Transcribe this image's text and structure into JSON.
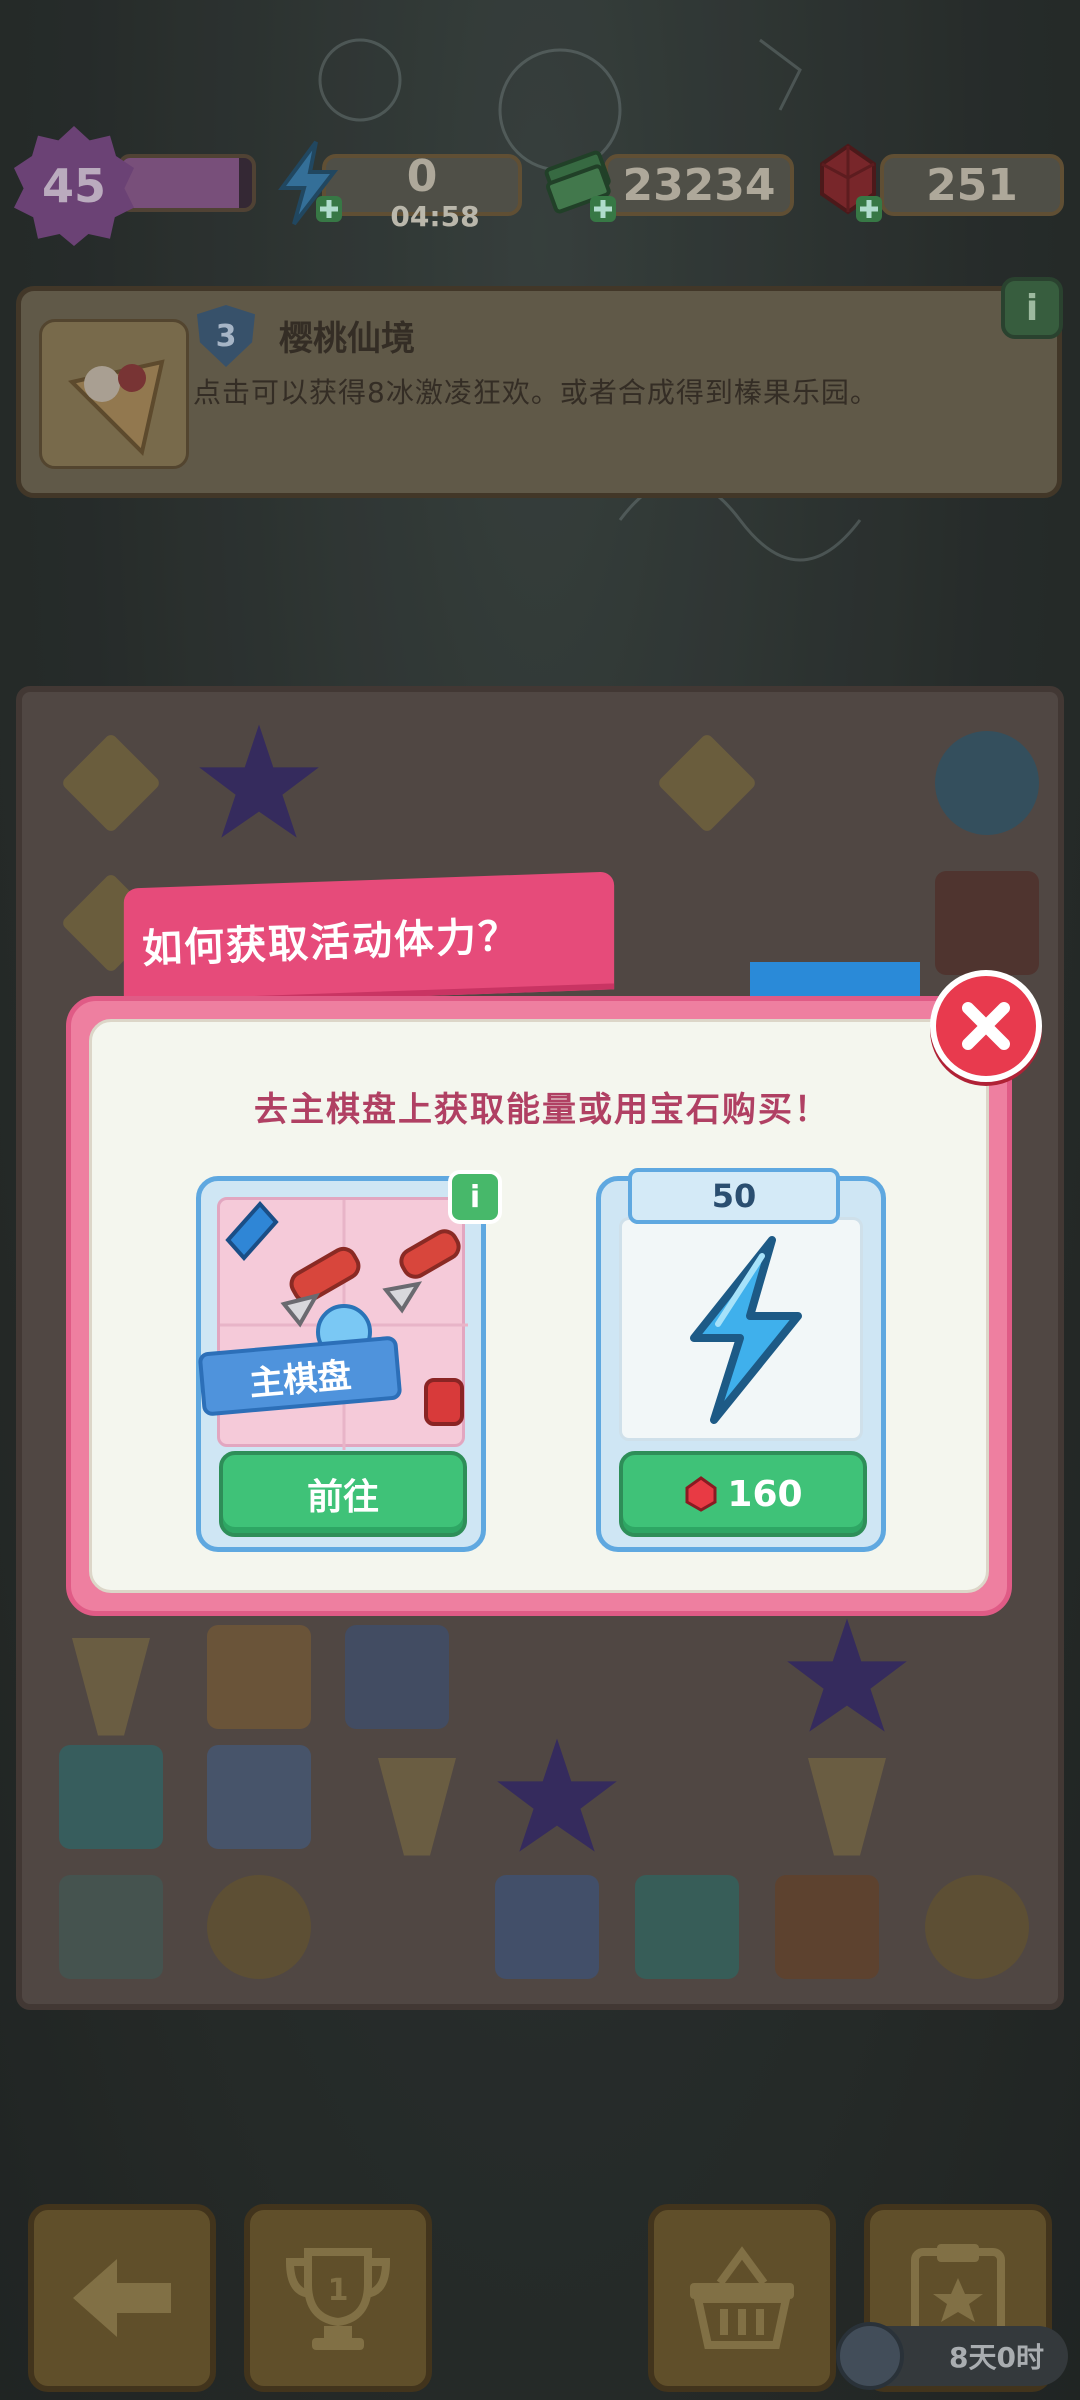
{
  "hud": {
    "level": "45",
    "xp_progress": 0.9,
    "energy_value": "0",
    "energy_timer": "04:58",
    "cash_value": "23234",
    "gem_value": "251"
  },
  "quest": {
    "badge_number": "3",
    "title": "樱桃仙境",
    "description": "点击可以获得8冰激凌狂欢。或者合成得到榛果乐园。",
    "info_label": "i"
  },
  "modal": {
    "tab_title": "如何获取活动体力？",
    "subtitle": "去主棋盘上获取能量或用宝石购买！",
    "card_main": {
      "ribbon_label": "主棋盘",
      "info_label": "i",
      "button_label": "前往"
    },
    "card_buy": {
      "quantity": "50",
      "price": "160"
    }
  },
  "bottom": {
    "trophy_rank": "1",
    "season_timer": "8天0时"
  },
  "colors": {
    "accent_pink": "#e64b7a",
    "button_green": "#3fc278",
    "card_blue": "#5fa8e0",
    "close_red": "#e83a4e"
  }
}
